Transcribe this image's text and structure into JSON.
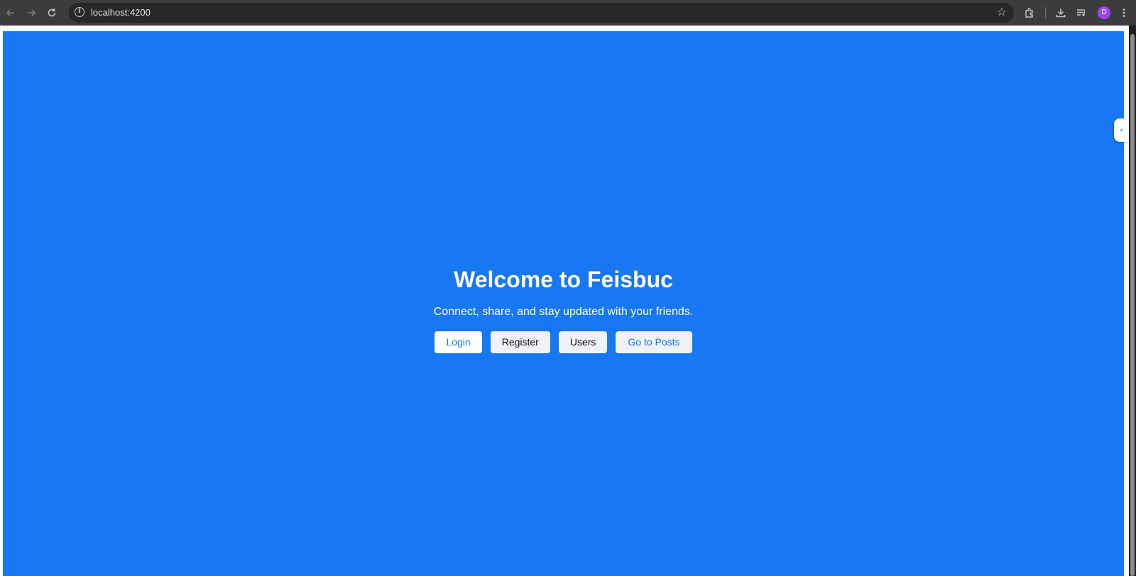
{
  "browser": {
    "url": "localhost:4200",
    "profile_initial": "D",
    "icons": {
      "back": "back-arrow-icon",
      "forward": "forward-arrow-icon",
      "reload": "reload-icon",
      "site_info": "info-icon",
      "bookmark": "star-icon",
      "extensions": "puzzle-icon",
      "downloads": "download-icon",
      "media": "media-playlist-icon",
      "menu": "kebab-menu-icon"
    }
  },
  "hero": {
    "title": "Welcome to Feisbuc",
    "subtitle": "Connect, share, and stay updated with your friends.",
    "buttons": {
      "login": "Login",
      "register": "Register",
      "users": "Users",
      "posts": "Go to Posts"
    }
  },
  "colors": {
    "page_background": "#1877f2",
    "primary_text_on_blue": "#ffffff",
    "button_light": "#f0f2f5",
    "button_white": "#ffffff",
    "link_blue": "#1877f2",
    "avatar": "#a142f4"
  }
}
